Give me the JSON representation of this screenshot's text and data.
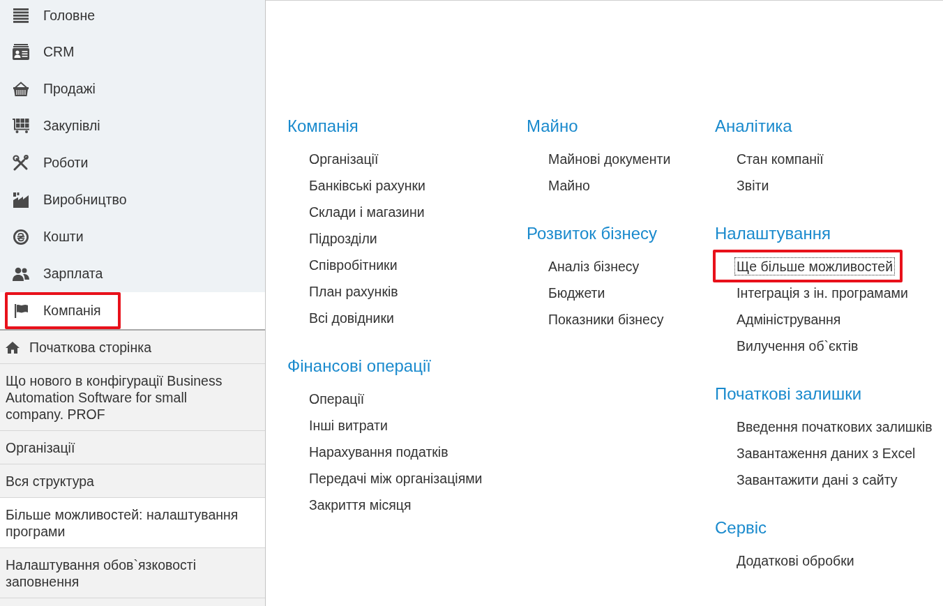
{
  "sidebar": {
    "sections": [
      {
        "label": "Головне",
        "selected": false,
        "highlighted": false
      },
      {
        "label": "CRM",
        "selected": false,
        "highlighted": false
      },
      {
        "label": "Продажі",
        "selected": false,
        "highlighted": false
      },
      {
        "label": "Закупівлі",
        "selected": false,
        "highlighted": false
      },
      {
        "label": "Роботи",
        "selected": false,
        "highlighted": false
      },
      {
        "label": "Виробництво",
        "selected": false,
        "highlighted": false
      },
      {
        "label": "Кошти",
        "selected": false,
        "highlighted": false
      },
      {
        "label": "Зарплата",
        "selected": false,
        "highlighted": false
      },
      {
        "label": "Компанія",
        "selected": true,
        "highlighted": true
      }
    ],
    "pages": [
      {
        "kind": "home",
        "label": "Початкова сторінка",
        "selected": false
      },
      {
        "kind": "page",
        "label": "Що нового в конфігурації Business Automation Software for small company. PROF",
        "selected": false
      },
      {
        "kind": "page",
        "label": "Організації",
        "selected": false
      },
      {
        "kind": "page",
        "label": "Вся структура",
        "selected": false
      },
      {
        "kind": "page",
        "label": "Більше можливостей: налаштування програми",
        "selected": true
      },
      {
        "kind": "page",
        "label": "Налаштування обов`язковості заповнення",
        "selected": false
      }
    ]
  },
  "content": {
    "columns": [
      {
        "groups": [
          {
            "title": "Компанія",
            "links": [
              {
                "label": "Організації",
                "focused": false,
                "highlighted": false
              },
              {
                "label": "Банківські рахунки",
                "focused": false,
                "highlighted": false
              },
              {
                "label": "Склади і магазини",
                "focused": false,
                "highlighted": false
              },
              {
                "label": "Підрозділи",
                "focused": false,
                "highlighted": false
              },
              {
                "label": "Співробітники",
                "focused": false,
                "highlighted": false
              },
              {
                "label": "План рахунків",
                "focused": false,
                "highlighted": false
              },
              {
                "label": "Всі довідники",
                "focused": false,
                "highlighted": false
              }
            ]
          },
          {
            "title": "Фінансові операції",
            "links": [
              {
                "label": "Операції",
                "focused": false,
                "highlighted": false
              },
              {
                "label": "Інші витрати",
                "focused": false,
                "highlighted": false
              },
              {
                "label": "Нарахування податків",
                "focused": false,
                "highlighted": false
              },
              {
                "label": "Передачі між організаціями",
                "focused": false,
                "highlighted": false
              },
              {
                "label": "Закриття місяця",
                "focused": false,
                "highlighted": false
              }
            ]
          }
        ]
      },
      {
        "groups": [
          {
            "title": "Майно",
            "links": [
              {
                "label": "Майнові документи",
                "focused": false,
                "highlighted": false
              },
              {
                "label": "Майно",
                "focused": false,
                "highlighted": false
              }
            ]
          },
          {
            "title": "Розвиток бізнесу",
            "links": [
              {
                "label": "Аналіз бізнесу",
                "focused": false,
                "highlighted": false
              },
              {
                "label": "Бюджети",
                "focused": false,
                "highlighted": false
              },
              {
                "label": "Показники бізнесу",
                "focused": false,
                "highlighted": false
              }
            ]
          }
        ]
      },
      {
        "groups": [
          {
            "title": "Аналітика",
            "links": [
              {
                "label": "Стан компанії",
                "focused": false,
                "highlighted": false
              },
              {
                "label": "Звіти",
                "focused": false,
                "highlighted": false
              }
            ]
          },
          {
            "title": "Налаштування",
            "links": [
              {
                "label": "Ще більше можливостей",
                "focused": true,
                "highlighted": true
              },
              {
                "label": "Інтеграція з ін. програмами",
                "focused": false,
                "highlighted": false
              },
              {
                "label": "Адміністрування",
                "focused": false,
                "highlighted": false
              },
              {
                "label": "Вилучення об`єктів",
                "focused": false,
                "highlighted": false
              }
            ]
          },
          {
            "title": "Початкові залишки",
            "links": [
              {
                "label": "Введення початкових залишків",
                "focused": false,
                "highlighted": false
              },
              {
                "label": "Завантаження даних з Excel",
                "focused": false,
                "highlighted": false
              },
              {
                "label": "Завантажити дані з сайту",
                "focused": false,
                "highlighted": false
              }
            ]
          },
          {
            "title": "Сервіс",
            "links": [
              {
                "label": "Додаткові обробки",
                "focused": false,
                "highlighted": false
              }
            ]
          }
        ]
      }
    ]
  }
}
